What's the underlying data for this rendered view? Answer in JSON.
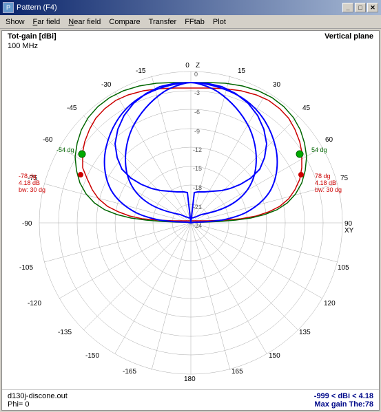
{
  "window": {
    "title": "Pattern  (F4)",
    "icon": "P"
  },
  "titlebar_buttons": {
    "minimize": "_",
    "maximize": "□",
    "close": "✕"
  },
  "menu": {
    "items": [
      {
        "label": "Show",
        "underline_index": 0
      },
      {
        "label": "Far field",
        "underline_index": 0
      },
      {
        "label": "Near field",
        "underline_index": 0
      },
      {
        "label": "Compare",
        "underline_index": 0
      },
      {
        "label": "Transfer",
        "underline_index": 0
      },
      {
        "label": "FFtab",
        "underline_index": 0
      },
      {
        "label": "Plot",
        "underline_index": 0
      }
    ]
  },
  "plot": {
    "y_axis_label": "Tot-gain [dBi]",
    "plane_label": "Vertical plane",
    "frequency": "100 MHz",
    "z_label": "Z",
    "xy_label": "XY"
  },
  "annotations": {
    "left_top": {
      "angle": "-54 dg",
      "color": "green"
    },
    "right_top": {
      "angle": "54 dg",
      "color": "green"
    },
    "left_bottom": {
      "angle": "-78 dg",
      "gain": "4.18 dB",
      "bw": "bw: 30 dg",
      "color": "red"
    },
    "right_bottom": {
      "angle": "78 dg",
      "gain": "4.18 dB",
      "bw": "bw: 30 dg",
      "color": "red"
    }
  },
  "status_bar": {
    "filename": "d130j-discone.out",
    "phi": "Phi= 0",
    "gain_range": "-999 < dBi < 4.18",
    "max_gain": "Max gain The:78"
  },
  "polar_rings": {
    "labels": [
      "0",
      "-3",
      "-6",
      "-9",
      "-12",
      "-15",
      "-18",
      "-21",
      "-24"
    ],
    "angle_labels": [
      "0",
      "15",
      "30",
      "45",
      "60",
      "75",
      "90",
      "105",
      "120",
      "135",
      "150",
      "165",
      "180",
      "165",
      "150",
      "135",
      "120",
      "105",
      "90",
      "75",
      "60",
      "45",
      "30",
      "15",
      "-15",
      "-30",
      "-45",
      "-60",
      "-75",
      "-78",
      "-90",
      "-105",
      "-120",
      "-135",
      "-150",
      "-165"
    ]
  }
}
